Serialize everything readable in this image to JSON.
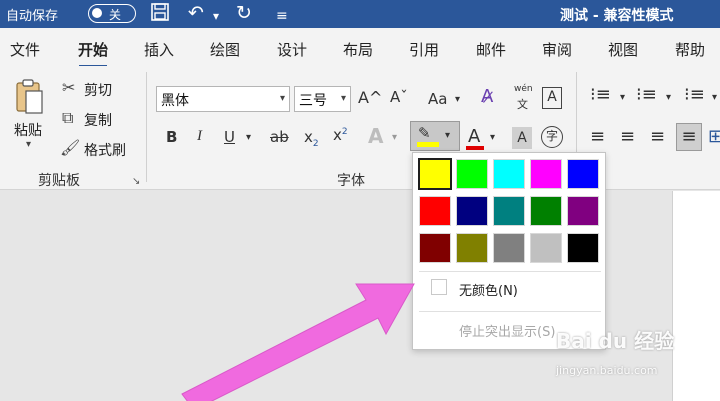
{
  "titlebar": {
    "autosave_label": "自动保存",
    "autosave_state": "关",
    "save_icon": "save-icon",
    "undo_icon": "undo-icon",
    "redo_icon": "redo-icon",
    "customize_icon": "customize-icon",
    "doc_title": "测试 - 兼容性模式"
  },
  "tabs": [
    "文件",
    "开始",
    "插入",
    "绘图",
    "设计",
    "布局",
    "引用",
    "邮件",
    "审阅",
    "视图",
    "帮助"
  ],
  "active_tab": "开始",
  "clipboard": {
    "paste_label": "粘贴",
    "cut_label": "剪切",
    "copy_label": "复制",
    "format_painter_label": "格式刷",
    "group_label": "剪贴板"
  },
  "font": {
    "font_name": "黑体",
    "font_size": "三号",
    "group_label": "字体",
    "grow_label": "A^",
    "shrink_label": "Aˇ",
    "case_label": "Aa",
    "phonetic_top": "wén",
    "phonetic_bottom": "文",
    "bold": "B",
    "italic": "I",
    "underline": "U",
    "strike": "ab",
    "subscript": "x",
    "subscript_small": "2",
    "superscript": "x",
    "superscript_small": "2",
    "effects": "A",
    "font_color": "A",
    "char_shading": "A",
    "enclose": "字"
  },
  "highlight_menu": {
    "colors": [
      [
        "#ffff00",
        "#00ff00",
        "#00ffff",
        "#ff00ff",
        "#0000ff"
      ],
      [
        "#ff0000",
        "#000080",
        "#008080",
        "#008000",
        "#800080"
      ],
      [
        "#800000",
        "#808000",
        "#808080",
        "#c0c0c0",
        "#000000"
      ]
    ],
    "selected_color": "#ffff00",
    "no_color_label": "无颜色(N)",
    "stop_label": "停止突出显示(S)"
  },
  "watermark": {
    "brand": "Bai du 经验",
    "url": "jingyan.baidu.com"
  },
  "colors": {
    "titlebar": "#2b579a",
    "arrow": "#f06adf"
  }
}
